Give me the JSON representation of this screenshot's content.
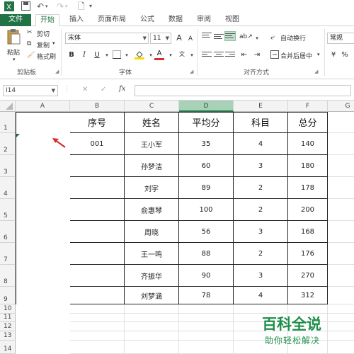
{
  "ribbon_tabs": [
    "文件",
    "开始",
    "插入",
    "页面布局",
    "公式",
    "数据",
    "审阅",
    "视图"
  ],
  "clipboard": {
    "paste": "粘贴",
    "cut": "剪切",
    "copy": "复制",
    "format_painter": "格式刷",
    "label": "剪贴板"
  },
  "font": {
    "name": "宋体",
    "size": "11",
    "bold": "B",
    "italic": "I",
    "underline": "U",
    "color_a": "A",
    "grow": "A",
    "shrink": "A",
    "label": "字体"
  },
  "alignment": {
    "wrap": "自动换行",
    "merge": "合并后居中",
    "label": "对齐方式"
  },
  "number": {
    "format": "常规"
  },
  "name_box": "I14",
  "formula": {
    "cancel": "✕",
    "enter": "✓",
    "fx": "fx"
  },
  "columns": [
    "A",
    "B",
    "C",
    "D",
    "E",
    "F",
    "G"
  ],
  "rows": [
    "1",
    "2",
    "3",
    "4",
    "5",
    "6",
    "7",
    "8",
    "9",
    "10",
    "11",
    "12",
    "13",
    "14"
  ],
  "table": {
    "headers": [
      "序号",
      "姓名",
      "平均分",
      "科目",
      "总分"
    ],
    "rows": [
      [
        "001",
        "王小军",
        "35",
        "4",
        "140"
      ],
      [
        "",
        "孙梦洁",
        "60",
        "3",
        "180"
      ],
      [
        "",
        "刘宇",
        "89",
        "2",
        "178"
      ],
      [
        "",
        "俞惠琴",
        "100",
        "2",
        "200"
      ],
      [
        "",
        "周晓",
        "56",
        "3",
        "168"
      ],
      [
        "",
        "王一鸣",
        "88",
        "2",
        "176"
      ],
      [
        "",
        "齐振华",
        "90",
        "3",
        "270"
      ],
      [
        "",
        "刘梦涵",
        "78",
        "4",
        "312"
      ]
    ]
  },
  "watermark": {
    "title": "百科全说",
    "subtitle": "助你轻松解决"
  },
  "colors": {
    "accent": "#217346",
    "header_selected": "#a9d1b8",
    "arrow": "#d32f2f",
    "watermark": "#1f8f4a"
  }
}
